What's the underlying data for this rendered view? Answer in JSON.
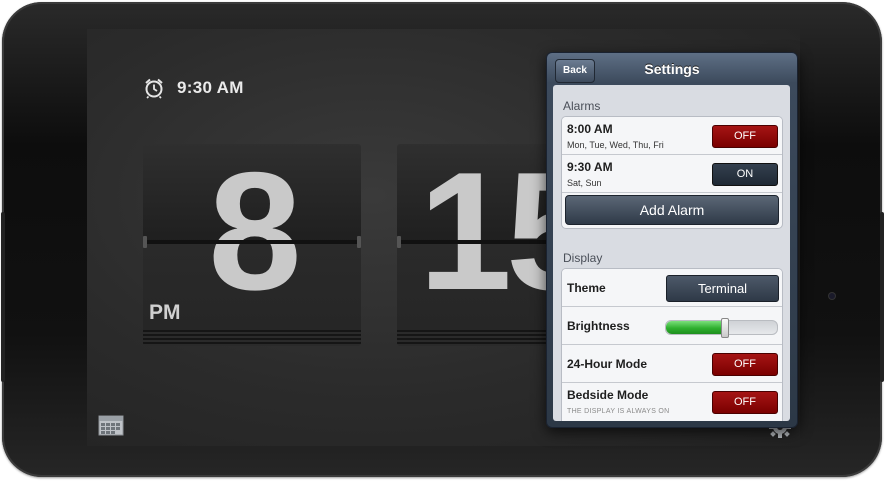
{
  "clock": {
    "alarm_time": "9:30 AM",
    "hour": "8",
    "minute": "15",
    "ampm": "PM"
  },
  "settings": {
    "title": "Settings",
    "back_label": "Back",
    "alarms_header": "Alarms",
    "alarms": [
      {
        "time": "8:00 AM",
        "days": "Mon, Tue, Wed, Thu, Fri",
        "state": "OFF"
      },
      {
        "time": "9:30 AM",
        "days": "Sat, Sun",
        "state": "ON"
      }
    ],
    "add_alarm_label": "Add Alarm",
    "display_header": "Display",
    "theme_label": "Theme",
    "theme_value": "Terminal",
    "brightness_label": "Brightness",
    "brightness_level": 0.52,
    "hour24_label": "24-Hour Mode",
    "hour24_state": "OFF",
    "bedside_label": "Bedside Mode",
    "bedside_note": "THE DISPLAY IS ALWAYS ON",
    "bedside_state": "OFF"
  },
  "colors": {
    "toggle_off": "#8b0a0a",
    "toggle_on": "#2a3441",
    "brightness_fill": "#34b534"
  },
  "icons": [
    "alarm-clock-icon",
    "calendar-icon",
    "gear-icon"
  ]
}
